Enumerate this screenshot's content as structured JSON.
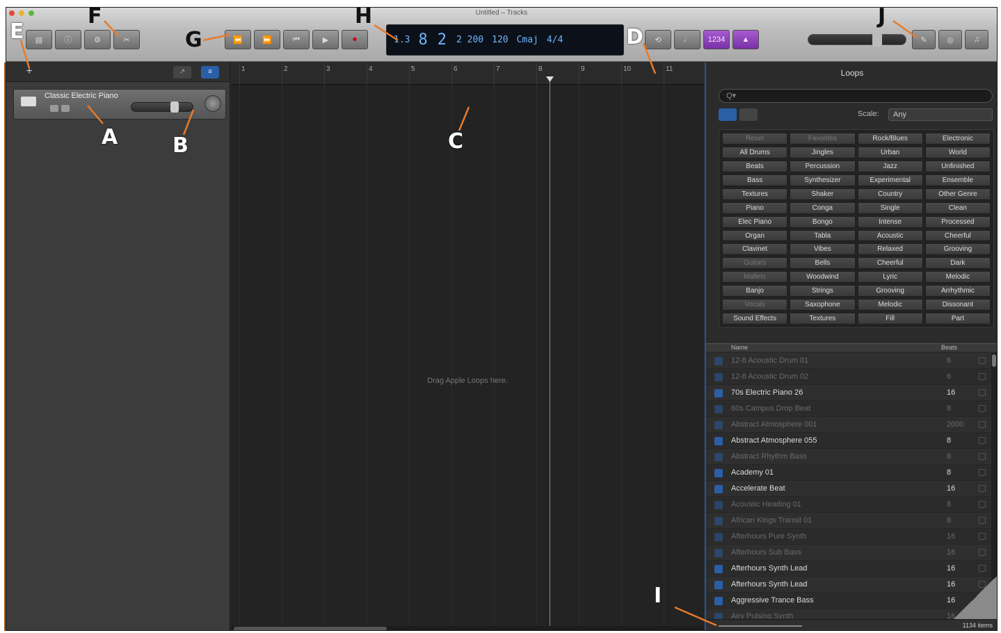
{
  "window": {
    "title": "Untitled – Tracks"
  },
  "toolbar": {
    "left_buttons": [
      "library-icon",
      "info-icon"
    ],
    "f_buttons": [
      "gear-icon",
      "scissors-icon"
    ],
    "transport": [
      "⏪",
      "⏩",
      "⏮",
      "▶",
      "⏺"
    ],
    "right_buttons": [
      "cycle-icon",
      "metronome-icon",
      "tuner-icon",
      "count-in-icon"
    ],
    "view_buttons": [
      "notepad-icon",
      "loop-browser-icon",
      "media-browser-icon"
    ]
  },
  "lcd": {
    "bar": "8",
    "beat": "2",
    "div_tick": "2 200",
    "tempo": "120",
    "key": "Cmaj",
    "time_sig": "4/4",
    "left_value": "1.3"
  },
  "track": {
    "name": "Classic Electric Piano"
  },
  "ruler": {
    "numbers": [
      "1",
      "2",
      "3",
      "4",
      "5",
      "6",
      "7",
      "8",
      "9",
      "10",
      "11"
    ]
  },
  "workspace": {
    "drop_text": "Drag Apple Loops here."
  },
  "browser": {
    "title": "Loops",
    "search_placeholder": "Q▾",
    "scale_label": "Scale:",
    "scale_value": "Any",
    "keywords": [
      "Reset",
      "Favorites",
      "Rock/Blues",
      "Electronic",
      "All Drums",
      "Jingles",
      "Urban",
      "World",
      "Beats",
      "Percussion",
      "Jazz",
      "Unfinished",
      "Bass",
      "Synthesizer",
      "Experimental",
      "Ensemble",
      "Textures",
      "Shaker",
      "Country",
      "Other Genre",
      "Piano",
      "Conga",
      "Single",
      "Clean",
      "Elec Piano",
      "Bongo",
      "Intense",
      "Processed",
      "Organ",
      "Tabla",
      "Acoustic",
      "Cheerful",
      "Clavinet",
      "Vibes",
      "Relaxed",
      "Grooving",
      "Guitars",
      "Bells",
      "Cheerful",
      "Dark",
      "Mallets",
      "Woodwind",
      "Lyric",
      "Melodic",
      "Banjo",
      "Strings",
      "Grooving",
      "Arrhythmic",
      "Vocals",
      "Saxophone",
      "Melodic",
      "Dissonant",
      "Sound Effects",
      "Textures",
      "Fill",
      "Part"
    ],
    "dim_keywords": [
      0,
      1,
      36,
      40,
      48
    ],
    "results_header": {
      "name": "Name",
      "beats": "Beats"
    },
    "results": [
      {
        "name": "12-8 Acoustic Drum 01",
        "beats": "6",
        "dim": true
      },
      {
        "name": "12-8 Acoustic Drum 02",
        "beats": "6",
        "dim": true
      },
      {
        "name": "70s Electric Piano 26",
        "beats": "16",
        "dim": false
      },
      {
        "name": "80s Campus Drop Beat",
        "beats": "8",
        "dim": true
      },
      {
        "name": "Abstract Atmosphere 001",
        "beats": "2000",
        "dim": true
      },
      {
        "name": "Abstract Atmosphere 055",
        "beats": "8",
        "dim": false
      },
      {
        "name": "Abstract Rhythm Bass",
        "beats": "8",
        "dim": true
      },
      {
        "name": "Academy 01",
        "beats": "8",
        "dim": false
      },
      {
        "name": "Accelerate Beat",
        "beats": "16",
        "dim": false
      },
      {
        "name": "Acoustic Heading 01",
        "beats": "8",
        "dim": true
      },
      {
        "name": "African Kings Transit 01",
        "beats": "8",
        "dim": true
      },
      {
        "name": "Afterhours Pure Synth",
        "beats": "16",
        "dim": true
      },
      {
        "name": "Afterhours Sub Bass",
        "beats": "16",
        "dim": true
      },
      {
        "name": "Afterhours Synth Lead",
        "beats": "16",
        "dim": false
      },
      {
        "name": "Afterhours Synth Lead",
        "beats": "16",
        "dim": false
      },
      {
        "name": "Aggressive Trance Bass",
        "beats": "16",
        "dim": false
      },
      {
        "name": "Airy Pulsing Synth",
        "beats": "16",
        "dim": true
      }
    ],
    "items_count": "1134 items"
  },
  "annotations": [
    "A",
    "B",
    "C",
    "D",
    "E",
    "F",
    "G",
    "H",
    "I",
    "J"
  ],
  "colors": {
    "accent": "#1b5aa0",
    "record": "#cc0000",
    "lcd_text": "#6fb7ff",
    "purple": "#a65cd0"
  }
}
